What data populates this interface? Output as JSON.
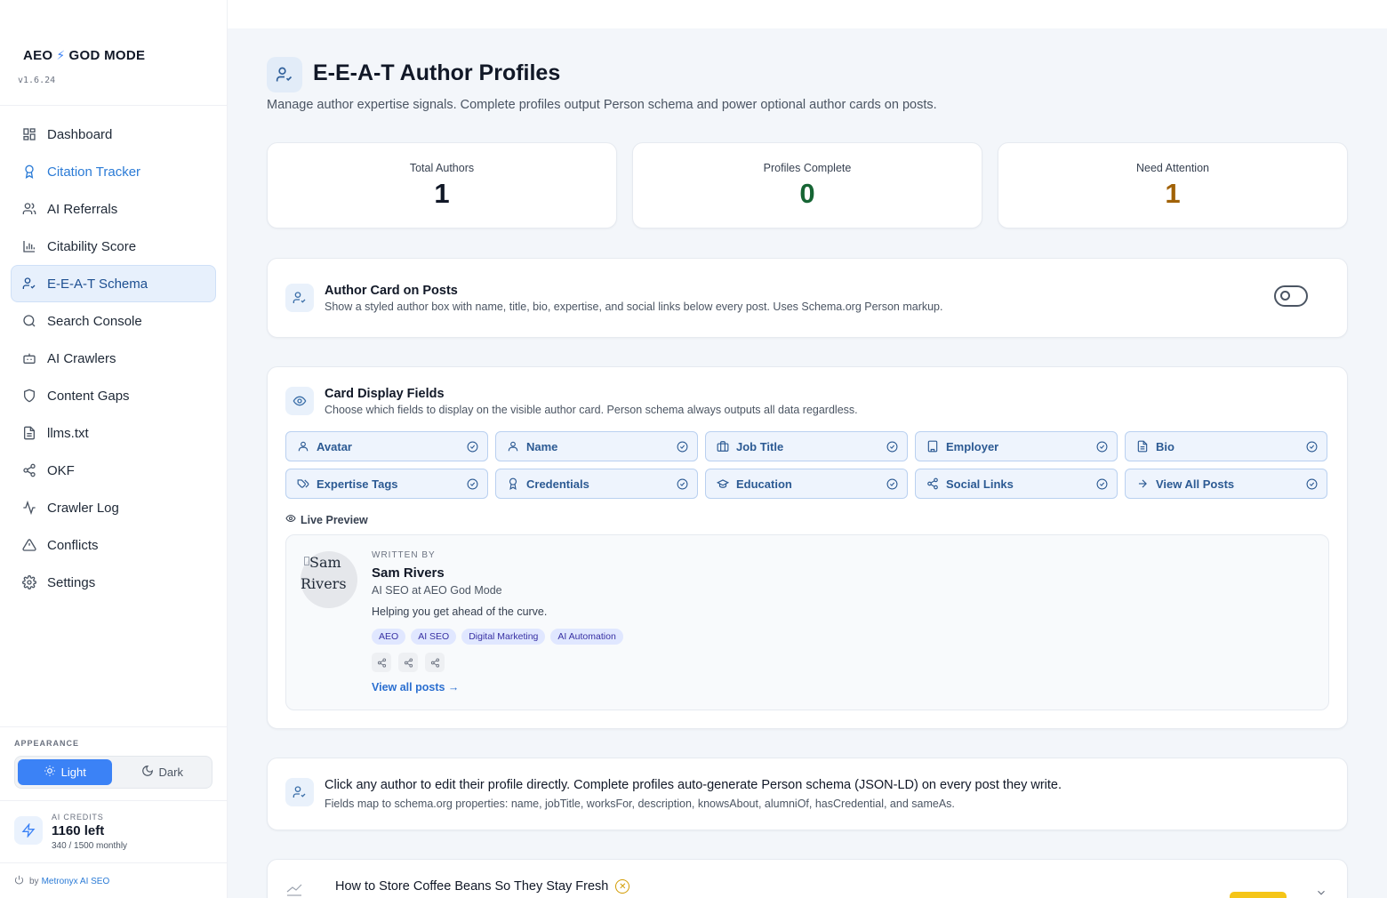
{
  "brand": {
    "name_left": "AEO",
    "bolt": "⚡",
    "name_right": "GOD MODE",
    "version": "v1.6.24"
  },
  "nav": [
    {
      "label": "Dashboard",
      "icon": "dashboard-icon"
    },
    {
      "label": "Citation Tracker",
      "icon": "award-icon"
    },
    {
      "label": "AI Referrals",
      "icon": "users-icon"
    },
    {
      "label": "Citability Score",
      "icon": "bar-chart-icon"
    },
    {
      "label": "E-E-A-T Schema",
      "icon": "user-check-icon"
    },
    {
      "label": "Search Console",
      "icon": "search-icon"
    },
    {
      "label": "AI Crawlers",
      "icon": "bot-icon"
    },
    {
      "label": "Content Gaps",
      "icon": "shield-icon"
    },
    {
      "label": "llms.txt",
      "icon": "file-text-icon"
    },
    {
      "label": "OKF",
      "icon": "share-icon"
    },
    {
      "label": "Crawler Log",
      "icon": "activity-icon"
    },
    {
      "label": "Conflicts",
      "icon": "alert-triangle-icon"
    },
    {
      "label": "Settings",
      "icon": "gear-icon"
    }
  ],
  "appearance": {
    "label": "APPEARANCE",
    "light": "Light",
    "dark": "Dark"
  },
  "credits": {
    "label": "AI CREDITS",
    "value": "1160 left",
    "sub": "340 / 1500 monthly"
  },
  "by": {
    "prefix": "by",
    "link": "Metronyx AI SEO"
  },
  "header": {
    "title": "E-E-A-T Author Profiles",
    "subtitle": "Manage author expertise signals. Complete profiles output Person schema and power optional author cards on posts."
  },
  "stats": [
    {
      "label": "Total Authors",
      "value": "1",
      "color": "#111827"
    },
    {
      "label": "Profiles Complete",
      "value": "0",
      "color": "#166534"
    },
    {
      "label": "Need Attention",
      "value": "1",
      "color": "#a16207"
    }
  ],
  "author_card": {
    "title": "Author Card on Posts",
    "desc": "Show a styled author box with name, title, bio, expertise, and social links below every post. Uses Schema.org Person markup.",
    "enabled": false
  },
  "display_fields": {
    "title": "Card Display Fields",
    "desc": "Choose which fields to display on the visible author card. Person schema always outputs all data regardless.",
    "fields": [
      {
        "label": "Avatar",
        "icon": "user-icon"
      },
      {
        "label": "Name",
        "icon": "user-icon"
      },
      {
        "label": "Job Title",
        "icon": "briefcase-icon"
      },
      {
        "label": "Employer",
        "icon": "building-icon"
      },
      {
        "label": "Bio",
        "icon": "file-text-icon"
      },
      {
        "label": "Expertise Tags",
        "icon": "tags-icon"
      },
      {
        "label": "Credentials",
        "icon": "award-icon"
      },
      {
        "label": "Education",
        "icon": "graduation-cap-icon"
      },
      {
        "label": "Social Links",
        "icon": "share-icon"
      },
      {
        "label": "View All Posts",
        "icon": "arrow-right-icon"
      }
    ],
    "live_preview_label": "Live Preview"
  },
  "preview": {
    "avatar_alt_line1": "Sam",
    "avatar_alt_line2": "Rivers",
    "written_by": "WRITTEN BY",
    "name": "Sam Rivers",
    "job": "AI SEO at AEO God Mode",
    "bio": "Helping you get ahead of the curve.",
    "tags": [
      "AEO",
      "AI SEO",
      "Digital Marketing",
      "AI Automation"
    ],
    "view_all": "View all posts →"
  },
  "info": {
    "title": "Click any author to edit their profile directly. Complete profiles auto-generate Person schema (JSON-LD) on every post they write.",
    "desc": "Fields map to schema.org properties: name, jobTitle, worksFor, description, knowsAbout, alumniOf, hasCredential, and sameAs."
  },
  "post": {
    "title": "How to Store Coffee Beans So They Stay Fresh",
    "status_icon": "x-circle-icon"
  }
}
